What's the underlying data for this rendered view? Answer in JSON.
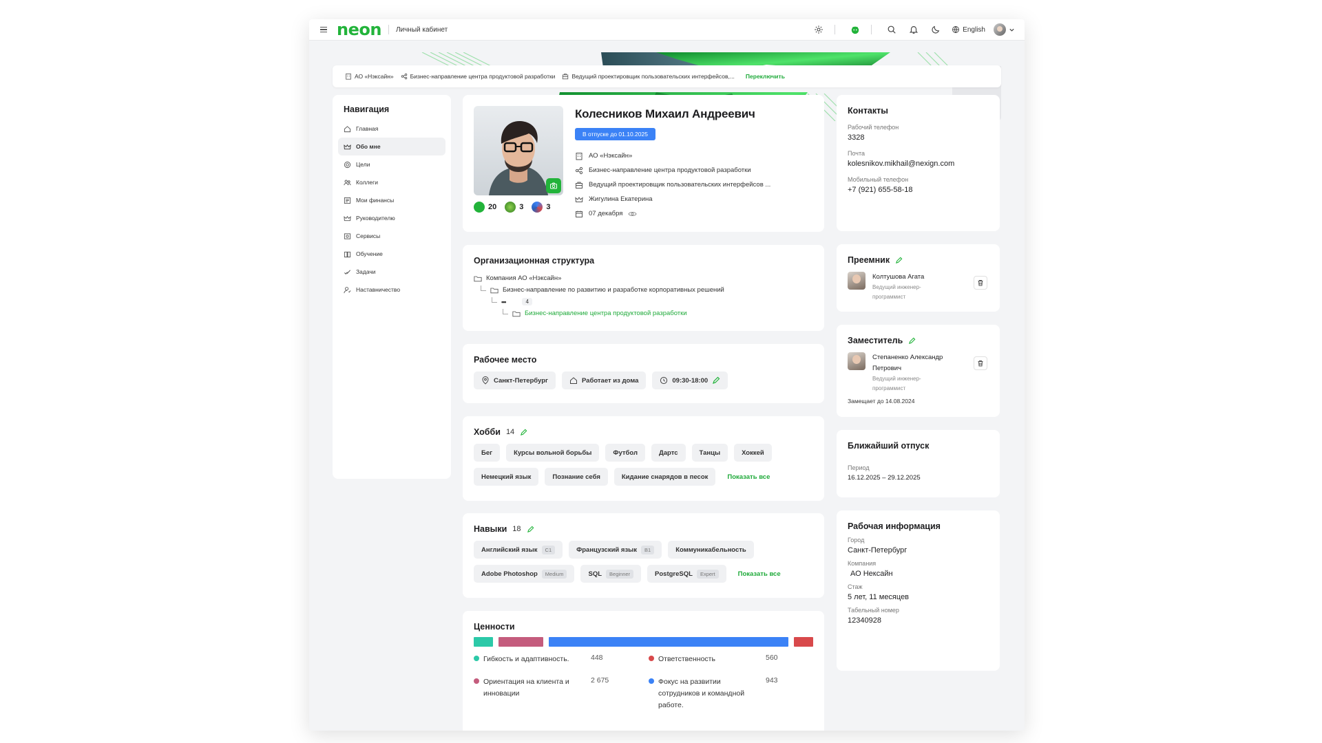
{
  "header": {
    "logo": "neon",
    "title": "Личный кабинет",
    "language": "English",
    "brand_color": "#22b33a"
  },
  "breadcrumb": {
    "items": [
      "АО «Нэксайн»",
      "Бизнес-направление центра продуктовой разработки",
      "Ведущий проектировщик пользовательских интерфейсов,..."
    ],
    "switch": "Переключить"
  },
  "nav": {
    "title": "Навигация",
    "items": [
      {
        "label": "Главная",
        "icon": "home-icon"
      },
      {
        "label": "Обо мне",
        "icon": "crown-icon",
        "active": true
      },
      {
        "label": "Цели",
        "icon": "target-icon"
      },
      {
        "label": "Коллеги",
        "icon": "people-icon"
      },
      {
        "label": "Мои финансы",
        "icon": "finance-icon"
      },
      {
        "label": "Руководителю",
        "icon": "crown-icon"
      },
      {
        "label": "Сервисы",
        "icon": "services-icon"
      },
      {
        "label": "Обучение",
        "icon": "book-icon"
      },
      {
        "label": "Задачи",
        "icon": "check-icon"
      },
      {
        "label": "Наставничество",
        "icon": "mentor-icon"
      }
    ]
  },
  "profile": {
    "name": "Колесников Михаил Андреевич",
    "vacation_badge": "В отпуске до 01.10.2025",
    "company": "АО «Нэксайн»",
    "division": "Бизнес-направление центра продуктовой разработки",
    "position": "Ведущий проектировщик пользовательских интерфейсов ...",
    "manager": "Жигулина Екатерина",
    "birthday": "07 декабря",
    "badges": [
      "20",
      "3",
      "3"
    ]
  },
  "org": {
    "title": "Организационная структура",
    "rows": [
      "Компания АО «Нэксайн»",
      "Бизнес-направление по развитию и разработке корпоративных решений",
      "4",
      "Бизнес-направление центра продуктовой разработки"
    ]
  },
  "workplace": {
    "title": "Рабочее место",
    "city": "Санкт-Петербург",
    "mode": "Работает из дома",
    "hours": "09:30-18:00"
  },
  "hobbies": {
    "title": "Хобби",
    "count": "14",
    "items": [
      "Бег",
      "Курсы вольной борьбы",
      "Футбол",
      "Дартс",
      "Танцы",
      "Хоккей",
      "Немецкий язык",
      "Познание себя",
      "Кидание снарядов в песок"
    ],
    "show_all": "Показать все"
  },
  "skills": {
    "title": "Навыки",
    "count": "18",
    "items": [
      {
        "name": "Английский язык",
        "level": "C1"
      },
      {
        "name": "Французский язык",
        "level": "B1"
      },
      {
        "name": "Коммуникабельность",
        "level": ""
      },
      {
        "name": "Adobe Photoshop",
        "level": "Medium"
      },
      {
        "name": "SQL",
        "level": "Beginner"
      },
      {
        "name": "PostgreSQL",
        "level": "Expert"
      }
    ],
    "show_all": "Показать все"
  },
  "values": {
    "title": "Ценности",
    "items": [
      {
        "label": "Гибкость и адаптивность.",
        "value": "448",
        "color": "#2cc9a8",
        "share": 448
      },
      {
        "label": "Ориентация на клиента и инновации",
        "value": "2 675",
        "color": "#c45c7d",
        "share": 1050
      },
      {
        "label": "Фокус на развитии сотрудников и командной работе.",
        "value": "943",
        "color": "#3b82f6",
        "share": 5600
      },
      {
        "label": "Ответственность",
        "value": "560",
        "color": "#d8494b",
        "share": 450
      }
    ]
  },
  "contacts": {
    "title": "Контакты",
    "work_phone_label": "Рабочий телефон",
    "work_phone": "3328",
    "email_label": "Почта",
    "email": "kolesnikov.mikhail@nexign.com",
    "mobile_label": "Мобильный телефон",
    "mobile": "+7 (921) 655-58-18"
  },
  "successor": {
    "title": "Преемник",
    "name": "Колтушова Агата",
    "role": "Ведущий инженер-программист"
  },
  "deputy": {
    "title": "Заместитель",
    "name": "Степаненко Александр Петрович",
    "role": "Ведущий инженер-программист",
    "replaces": "Замещает до 14.08.2024"
  },
  "nearest_vacation": {
    "title": "Ближайший отпуск",
    "period_label": "Период",
    "period": "16.12.2025 – 29.12.2025"
  },
  "work_info": {
    "title": "Рабочая информация",
    "city_label": "Город",
    "city": "Санкт-Петербург",
    "company_label": "Компания",
    "company": "АО Нексайн",
    "tenure_label": "Стаж",
    "tenure": "5 лет, 11 месяцев",
    "id_label": "Табельный номер",
    "id": "12340928"
  }
}
